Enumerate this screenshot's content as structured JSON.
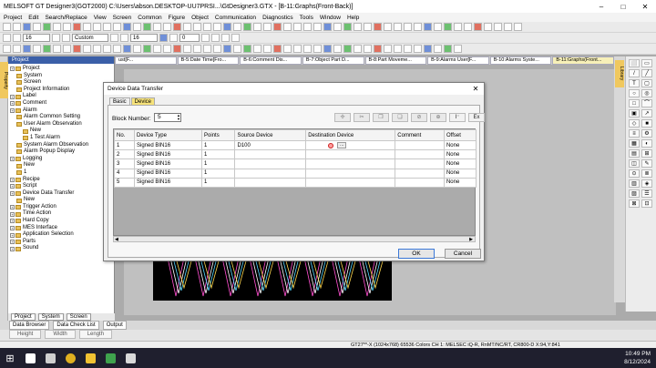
{
  "window": {
    "title": "MELSOFT GT Designer3(GOT2000) C:\\Users\\abson.DESKTOP-UU7PRSI...\\GtDesigner3.GTX - [B-11:Graphs(Front-Back)]",
    "controls": [
      "–",
      "□",
      "✕"
    ]
  },
  "menu": [
    "Project",
    "Edit",
    "Search/Replace",
    "View",
    "Screen",
    "Common",
    "Figure",
    "Object",
    "Communication",
    "Diagnostics",
    "Tools",
    "Window",
    "Help"
  ],
  "toolbar": {
    "font_size": "16",
    "style": "Custom",
    "size2": "16",
    "rotate": "0"
  },
  "left_strip": {
    "label": "Property"
  },
  "project": {
    "header": "Project",
    "tree": [
      {
        "indent": 1,
        "label": "Project"
      },
      {
        "indent": 2,
        "label": "System"
      },
      {
        "indent": 2,
        "label": "Screen"
      },
      {
        "indent": 2,
        "label": "Project Information"
      },
      {
        "indent": 1,
        "label": "Label"
      },
      {
        "indent": 1,
        "label": "Comment"
      },
      {
        "indent": 1,
        "label": "Alarm"
      },
      {
        "indent": 2,
        "label": "Alarm Common Setting"
      },
      {
        "indent": 2,
        "label": "User Alarm Observation"
      },
      {
        "indent": 3,
        "label": "New"
      },
      {
        "indent": 3,
        "label": "1 Test Alarm"
      },
      {
        "indent": 2,
        "label": "System Alarm Observation"
      },
      {
        "indent": 2,
        "label": "Alarm Popup Display"
      },
      {
        "indent": 1,
        "label": "Logging"
      },
      {
        "indent": 2,
        "label": "New"
      },
      {
        "indent": 2,
        "label": "1"
      },
      {
        "indent": 1,
        "label": "Recipe"
      },
      {
        "indent": 1,
        "label": "Script"
      },
      {
        "indent": 1,
        "label": "Device Data Transfer"
      },
      {
        "indent": 2,
        "label": "New"
      },
      {
        "indent": 1,
        "label": "Trigger Action"
      },
      {
        "indent": 1,
        "label": "Time Action"
      },
      {
        "indent": 1,
        "label": "Hard Copy"
      },
      {
        "indent": 1,
        "label": "MES Interface"
      },
      {
        "indent": 1,
        "label": "Application Selection"
      },
      {
        "indent": 1,
        "label": "Parts"
      },
      {
        "indent": 1,
        "label": "Sound"
      }
    ],
    "tabs": [
      "Project",
      "System",
      "Screen"
    ]
  },
  "doc_tabs": [
    {
      "label": "ust[F...",
      "active": false
    },
    {
      "label": "B-5:Date Time[Fro...",
      "active": false
    },
    {
      "label": "B-6:Comment Dis...",
      "active": false
    },
    {
      "label": "B-7:Object Part D...",
      "active": false
    },
    {
      "label": "B-8:Part Moveme...",
      "active": false
    },
    {
      "label": "B-9:Alarms User[F...",
      "active": false
    },
    {
      "label": "B-10:Alarms Syste...",
      "active": false
    },
    {
      "label": "B-11:Graphs(Front...",
      "active": true
    }
  ],
  "right_strip": {
    "label": "Library"
  },
  "right_tools": [
    "⬜",
    "▭",
    "/",
    "╱",
    "T",
    "▢",
    "○",
    "◎",
    "□",
    "⌒",
    "▣",
    "↗",
    "◇",
    "■",
    "≡",
    "⚙",
    "▦",
    "◐",
    "▤",
    "⊞",
    "◫",
    "✎",
    "⊙",
    "≣",
    "▥",
    "◈",
    "▨",
    "☰",
    "⊠",
    "⊡"
  ],
  "bottom": {
    "panels": [
      "Data Browser",
      "Data Check List",
      "Output"
    ],
    "row2": [
      "Height",
      "Width",
      "Length"
    ]
  },
  "status": {
    "text": "GT27**-X (1024x768)   65536 Colors   CH 1: MELSEC iQ-R, RnMT/NC/RT, CR800-D     X:94,Y:841"
  },
  "taskbar": {
    "time": "10:49 PM",
    "date": "8/12/2024",
    "icons": [
      {
        "name": "search",
        "color": "#ffffff"
      },
      {
        "name": "task-view",
        "color": "#cfcfcf"
      },
      {
        "name": "chrome",
        "color": "#e0b020"
      },
      {
        "name": "explorer",
        "color": "#f1c232"
      },
      {
        "name": "gt-designer",
        "color": "#3fa34d"
      },
      {
        "name": "media",
        "color": "#d9d9d9"
      }
    ]
  },
  "dialog": {
    "title": "Device Data Transfer",
    "close": "✕",
    "tabs": [
      {
        "label": "Basic",
        "active": false
      },
      {
        "label": "Device",
        "active": true
      }
    ],
    "block_label": "Block Number:",
    "block_value": "5",
    "icons": [
      {
        "glyph": "✢",
        "on": false
      },
      {
        "glyph": "✂",
        "on": false
      },
      {
        "glyph": "❐",
        "on": false
      },
      {
        "glyph": "❏",
        "on": false
      },
      {
        "glyph": "⊘",
        "on": false
      },
      {
        "glyph": "⊕",
        "on": false
      },
      {
        "glyph": "I⁻",
        "on": true
      },
      {
        "glyph": "Ex",
        "on": true
      }
    ],
    "columns": [
      "No.",
      "Device Type",
      "Points",
      "Source Device",
      "Destination Device",
      "Comment",
      "Offset"
    ],
    "rows": [
      {
        "no": "1",
        "type": "Signed BIN16",
        "points": "1",
        "source": "D100",
        "dest": "",
        "comment": "",
        "offset": "None"
      },
      {
        "no": "2",
        "type": "Signed BIN16",
        "points": "1",
        "source": "",
        "dest": "",
        "comment": "",
        "offset": "None"
      },
      {
        "no": "3",
        "type": "Signed BIN16",
        "points": "1",
        "source": "",
        "dest": "",
        "comment": "",
        "offset": "None"
      },
      {
        "no": "4",
        "type": "Signed BIN16",
        "points": "1",
        "source": "",
        "dest": "",
        "comment": "",
        "offset": "None"
      },
      {
        "no": "5",
        "type": "Signed BIN16",
        "points": "1",
        "source": "",
        "dest": "",
        "comment": "",
        "offset": "None"
      }
    ],
    "ok": "OK",
    "cancel": "Cancel"
  }
}
